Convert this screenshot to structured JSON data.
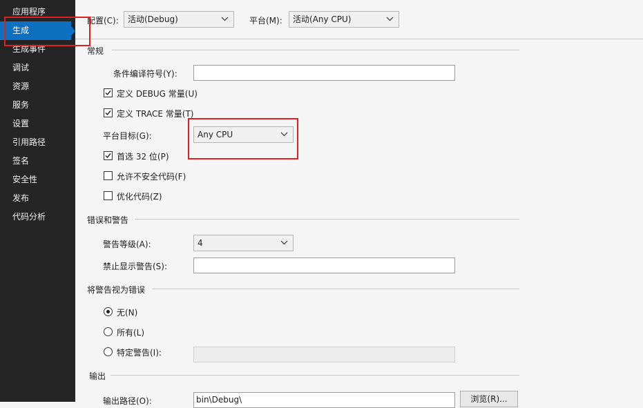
{
  "sidebar": {
    "items": [
      {
        "label": "应用程序"
      },
      {
        "label": "生成"
      },
      {
        "label": "生成事件"
      },
      {
        "label": "调试"
      },
      {
        "label": "资源"
      },
      {
        "label": "服务"
      },
      {
        "label": "设置"
      },
      {
        "label": "引用路径"
      },
      {
        "label": "签名"
      },
      {
        "label": "安全性"
      },
      {
        "label": "发布"
      },
      {
        "label": "代码分析"
      }
    ],
    "active_index": 1
  },
  "toolbar": {
    "config_label": "配置(C):",
    "config_value": "活动(Debug)",
    "platform_label": "平台(M):",
    "platform_value": "活动(Any CPU)"
  },
  "general": {
    "title": "常规",
    "symbols_label": "条件编译符号(Y):",
    "symbols_value": "",
    "define_debug_label": "定义 DEBUG 常量(U)",
    "define_debug_checked": true,
    "define_trace_label": "定义 TRACE 常量(T)",
    "define_trace_checked": true,
    "platform_target_label": "平台目标(G):",
    "platform_target_value": "Any CPU",
    "prefer32_label": "首选 32 位(P)",
    "prefer32_checked": true,
    "unsafe_label": "允许不安全代码(F)",
    "unsafe_checked": false,
    "optimize_label": "优化代码(Z)",
    "optimize_checked": false
  },
  "errors": {
    "title": "错误和警告",
    "warning_level_label": "警告等级(A):",
    "warning_level_value": "4",
    "suppress_label": "禁止显示警告(S):",
    "suppress_value": ""
  },
  "treat_warnings": {
    "title": "将警告视为错误",
    "none_label": "无(N)",
    "all_label": "所有(L)",
    "specific_label": "特定警告(I):",
    "selected": "none",
    "specific_value": ""
  },
  "output": {
    "title": "输出",
    "path_label": "输出路径(O):",
    "path_value": "bin\\Debug\\",
    "browse_label": "浏览(R)..."
  },
  "colors": {
    "sidebar_bg": "#252526",
    "active_bg": "#0e70c0",
    "highlight": "#e02020"
  }
}
